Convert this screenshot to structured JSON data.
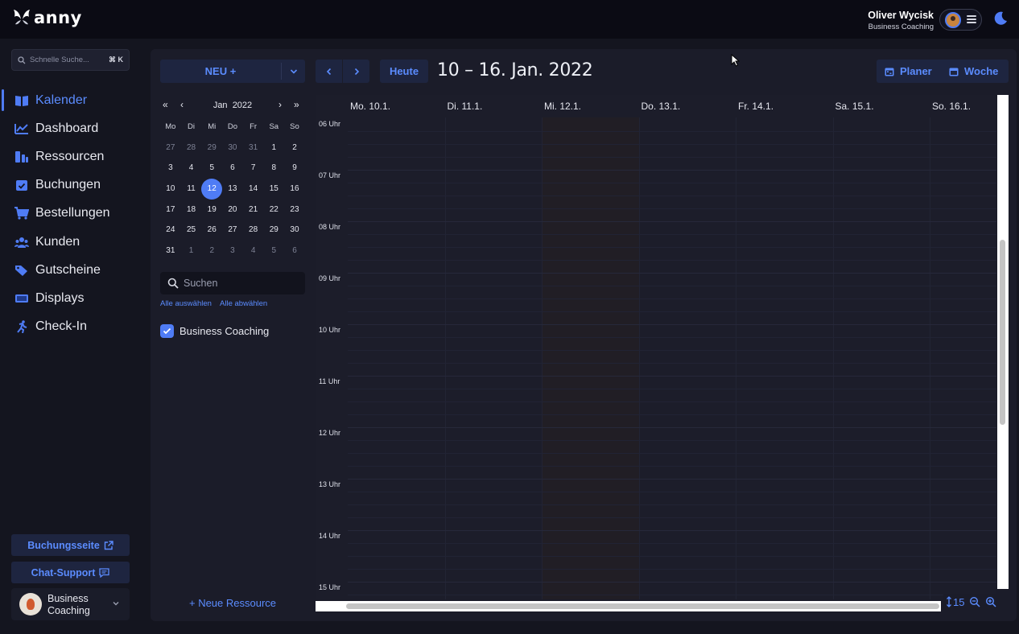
{
  "app": {
    "name": "anny"
  },
  "user": {
    "name": "Oliver Wycisk",
    "org": "Business Coaching"
  },
  "sidebar": {
    "search_placeholder": "Schnelle Suche...",
    "search_shortcut": "⌘ K",
    "items": [
      {
        "label": "Kalender",
        "icon": "calendar-book-icon",
        "active": true
      },
      {
        "label": "Dashboard",
        "icon": "chart-line-icon"
      },
      {
        "label": "Ressourcen",
        "icon": "resources-icon"
      },
      {
        "label": "Buchungen",
        "icon": "calendar-check-icon"
      },
      {
        "label": "Bestellungen",
        "icon": "cart-icon"
      },
      {
        "label": "Kunden",
        "icon": "users-icon"
      },
      {
        "label": "Gutscheine",
        "icon": "tags-icon"
      },
      {
        "label": "Displays",
        "icon": "display-icon"
      },
      {
        "label": "Check-In",
        "icon": "running-icon"
      }
    ],
    "booking_page": "Buchungsseite",
    "chat_support": "Chat-Support",
    "company": "Business Coaching"
  },
  "toolbar": {
    "new_label": "NEU +",
    "today_label": "Heute",
    "range_title": "10 – 16. Jan. 2022",
    "planner_label": "Planer",
    "week_label": "Woche"
  },
  "mini_calendar": {
    "month": "Jan",
    "year": "2022",
    "weekdays": [
      "Mo",
      "Di",
      "Mi",
      "Do",
      "Fr",
      "Sa",
      "So"
    ],
    "weeks": [
      [
        "27",
        "28",
        "29",
        "30",
        "31",
        "1",
        "2"
      ],
      [
        "3",
        "4",
        "5",
        "6",
        "7",
        "8",
        "9"
      ],
      [
        "10",
        "11",
        "12",
        "13",
        "14",
        "15",
        "16"
      ],
      [
        "17",
        "18",
        "19",
        "20",
        "21",
        "22",
        "23"
      ],
      [
        "24",
        "25",
        "26",
        "27",
        "28",
        "29",
        "30"
      ],
      [
        "31",
        "1",
        "2",
        "3",
        "4",
        "5",
        "6"
      ]
    ],
    "selected": "12"
  },
  "resources": {
    "search_placeholder": "Suchen",
    "select_all": "Alle auswählen",
    "deselect_all": "Alle abwählen",
    "items": [
      {
        "label": "Business Coaching",
        "checked": true
      }
    ],
    "new_resource": "+ Neue Ressource"
  },
  "week": {
    "days": [
      "Mo. 10.1.",
      "Di. 11.1.",
      "Mi. 12.1.",
      "Do. 13.1.",
      "Fr. 14.1.",
      "Sa. 15.1.",
      "So. 16.1."
    ],
    "hours": [
      "06 Uhr",
      "07 Uhr",
      "08 Uhr",
      "09 Uhr",
      "10 Uhr",
      "11 Uhr",
      "12 Uhr",
      "13 Uhr",
      "14 Uhr",
      "15 Uhr"
    ]
  },
  "zoom": {
    "interval": "15"
  },
  "colors": {
    "accent": "#4f7cf5",
    "link": "#5b8cff",
    "background": "#14151f",
    "panel": "#1b1c29",
    "button": "#1e2540"
  }
}
